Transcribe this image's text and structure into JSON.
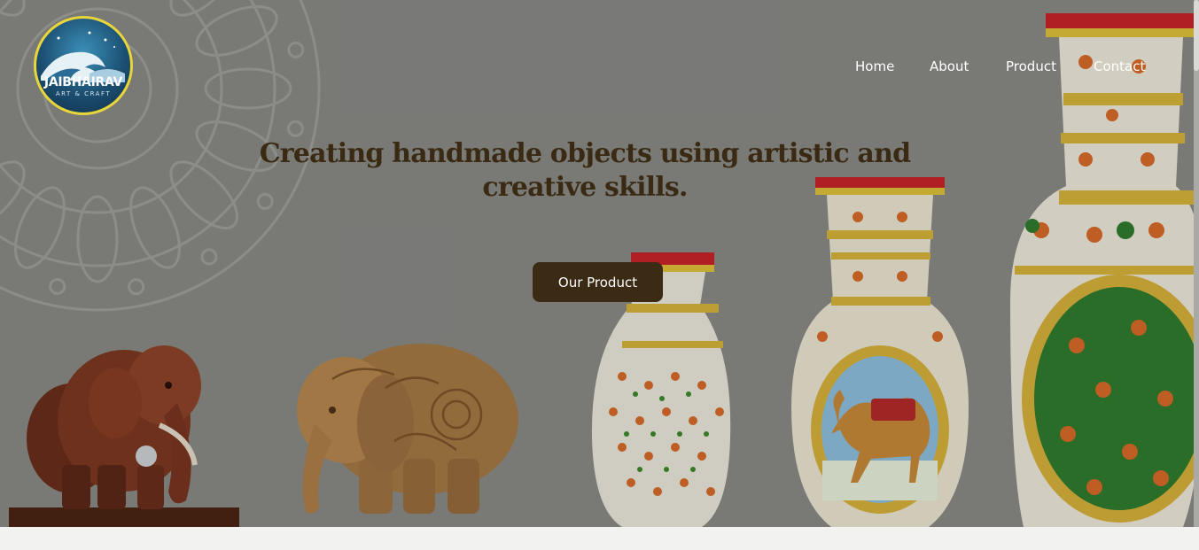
{
  "brand": {
    "name": "JAIBHAIRAV",
    "subtitle": "ART & CRAFT",
    "logo_icon": "wave-logo-icon",
    "ring_color": "#e8d63a"
  },
  "nav": {
    "items": [
      {
        "label": "Home"
      },
      {
        "label": "About"
      },
      {
        "label": "Product"
      },
      {
        "label": "Contact"
      }
    ]
  },
  "hero": {
    "headline": "Creating handmade objects using artistic and creative skills.",
    "cta_label": "Our Product",
    "background_color": "#8a8b87",
    "headline_color": "#3a2a14",
    "cta_color": "#3b2a14"
  },
  "products": {
    "items": [
      {
        "icon": "rosewood-elephant-image"
      },
      {
        "icon": "carved-wooden-elephant-image"
      },
      {
        "icon": "small-painted-vase-image"
      },
      {
        "icon": "camel-painted-vase-image"
      },
      {
        "icon": "large-floral-vase-image"
      }
    ]
  }
}
